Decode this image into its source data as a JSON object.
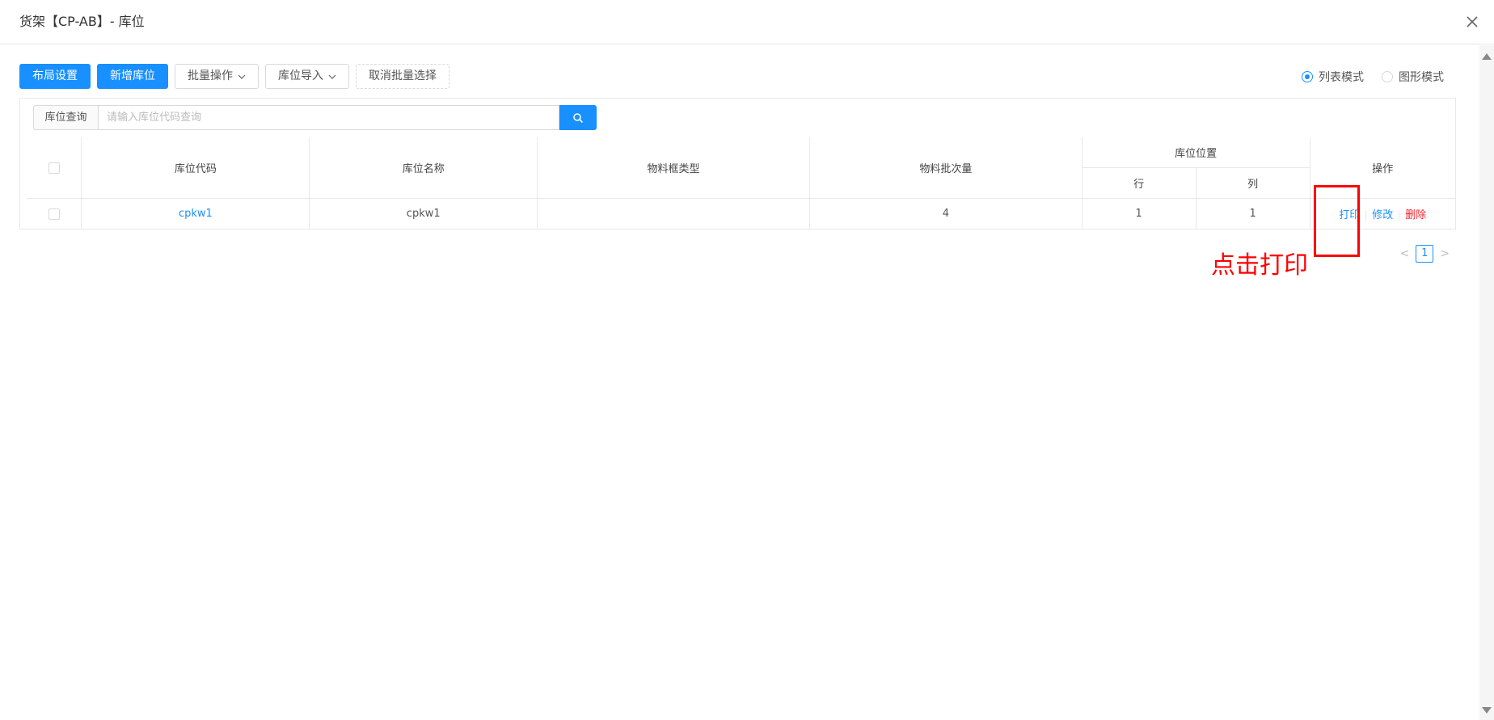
{
  "dialog": {
    "title": "货架【CP-AB】- 库位"
  },
  "toolbar": {
    "layout_settings": "布局设置",
    "add_location": "新增库位",
    "batch_ops": "批量操作",
    "location_import": "库位导入",
    "cancel_batch": "取消批量选择"
  },
  "view_mode": {
    "list": "列表模式",
    "graphic": "图形模式",
    "selected": "list"
  },
  "search": {
    "label": "库位查询",
    "placeholder": "请输入库位代码查询",
    "value": ""
  },
  "table": {
    "headers": {
      "code": "库位代码",
      "name": "库位名称",
      "box_type": "物料框类型",
      "batch_qty": "物料批次量",
      "position": "库位位置",
      "row": "行",
      "col": "列",
      "actions": "操作"
    },
    "rows": [
      {
        "code": "cpkw1",
        "name": "cpkw1",
        "box_type": "",
        "batch_qty": "4",
        "row": "1",
        "col": "1",
        "actions": {
          "print": "打印",
          "edit": "修改",
          "delete": "删除"
        }
      }
    ]
  },
  "pagination": {
    "current": "1",
    "prev": "<",
    "next": ">"
  },
  "annotation": {
    "text": "点击打印",
    "color": "#ff0000"
  },
  "colors": {
    "primary": "#1890ff",
    "danger": "#f5222d"
  }
}
